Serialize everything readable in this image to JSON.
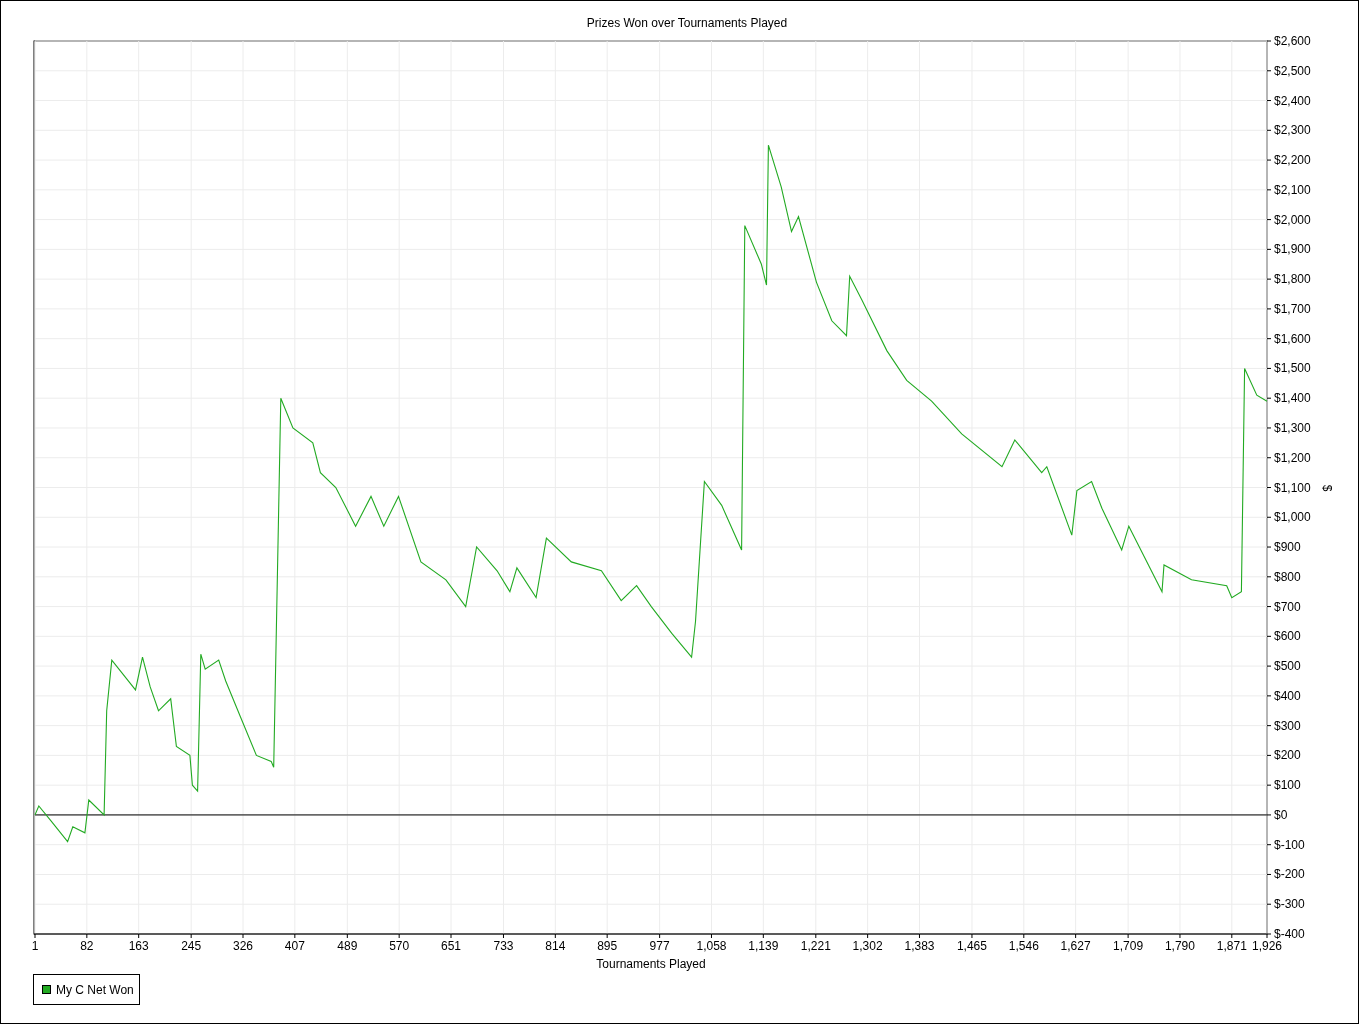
{
  "chart": {
    "chart_data": {
      "type": "line",
      "title": "Prizes Won over Tournaments Played",
      "xlabel": "Tournaments Played",
      "ylabel": "$",
      "x": [
        1,
        7,
        26,
        52,
        60,
        79,
        85,
        109,
        113,
        121,
        158,
        169,
        181,
        194,
        213,
        222,
        243,
        247,
        255,
        260,
        267,
        288,
        299,
        322,
        347,
        370,
        374,
        380,
        385,
        404,
        435,
        447,
        471,
        502,
        526,
        546,
        569,
        604,
        643,
        674,
        691,
        723,
        743,
        754,
        784,
        800,
        839,
        886,
        917,
        941,
        964,
        996,
        1027,
        1033,
        1047,
        1074,
        1105,
        1110,
        1136,
        1144,
        1147,
        1167,
        1183,
        1194,
        1222,
        1246,
        1269,
        1274,
        1293,
        1332,
        1363,
        1402,
        1449,
        1512,
        1532,
        1574,
        1582,
        1621,
        1629,
        1652,
        1668,
        1699,
        1710,
        1762,
        1765,
        1808,
        1863,
        1871,
        1886,
        1891,
        1910,
        1926
      ],
      "series": [
        {
          "name": "My C Net Won",
          "color": "#22aa22",
          "values": [
            0,
            30,
            -20,
            -90,
            -40,
            -60,
            50,
            0,
            350,
            520,
            420,
            530,
            430,
            350,
            390,
            230,
            200,
            100,
            80,
            540,
            490,
            520,
            450,
            330,
            200,
            180,
            160,
            840,
            1400,
            1300,
            1250,
            1150,
            1100,
            970,
            1070,
            970,
            1070,
            850,
            790,
            700,
            900,
            820,
            750,
            830,
            730,
            930,
            850,
            820,
            720,
            770,
            700,
            610,
            530,
            650,
            1120,
            1040,
            890,
            1980,
            1850,
            1780,
            2250,
            2110,
            1960,
            2010,
            1790,
            1660,
            1610,
            1810,
            1730,
            1560,
            1460,
            1390,
            1280,
            1170,
            1260,
            1150,
            1170,
            940,
            1090,
            1120,
            1030,
            890,
            970,
            750,
            840,
            790,
            770,
            730,
            750,
            1500,
            1410,
            1390
          ]
        }
      ],
      "grid": true,
      "xlim": [
        1,
        1926
      ],
      "ylim": [
        -400,
        2600
      ],
      "xticks": [
        1,
        82,
        163,
        245,
        326,
        407,
        489,
        570,
        651,
        733,
        814,
        895,
        977,
        {
          "value": 1058,
          "label": "1,058"
        },
        {
          "value": 1139,
          "label": "1,139"
        },
        {
          "value": 1221,
          "label": "1,221"
        },
        {
          "value": 1302,
          "label": "1,302"
        },
        {
          "value": 1383,
          "label": "1,383"
        },
        {
          "value": 1465,
          "label": "1,465"
        },
        {
          "value": 1546,
          "label": "1,546"
        },
        {
          "value": 1627,
          "label": "1,627"
        },
        {
          "value": 1709,
          "label": "1,709"
        },
        {
          "value": 1790,
          "label": "1,790"
        },
        {
          "value": 1871,
          "label": "1,871"
        },
        {
          "value": 1926,
          "label": "1,926"
        }
      ],
      "yticks": [
        {
          "value": -400,
          "label": "$-400"
        },
        {
          "value": -300,
          "label": "$-300"
        },
        {
          "value": -200,
          "label": "$-200"
        },
        {
          "value": -100,
          "label": "$-100"
        },
        {
          "value": 0,
          "label": "$0"
        },
        {
          "value": 100,
          "label": "$100"
        },
        {
          "value": 200,
          "label": "$200"
        },
        {
          "value": 300,
          "label": "$300"
        },
        {
          "value": 400,
          "label": "$400"
        },
        {
          "value": 500,
          "label": "$500"
        },
        {
          "value": 600,
          "label": "$600"
        },
        {
          "value": 700,
          "label": "$700"
        },
        {
          "value": 800,
          "label": "$800"
        },
        {
          "value": 900,
          "label": "$900"
        },
        {
          "value": 1000,
          "label": "$1,000"
        },
        {
          "value": 1100,
          "label": "$1,100"
        },
        {
          "value": 1200,
          "label": "$1,200"
        },
        {
          "value": 1300,
          "label": "$1,300"
        },
        {
          "value": 1400,
          "label": "$1,400"
        },
        {
          "value": 1500,
          "label": "$1,500"
        },
        {
          "value": 1600,
          "label": "$1,600"
        },
        {
          "value": 1700,
          "label": "$1,700"
        },
        {
          "value": 1800,
          "label": "$1,800"
        },
        {
          "value": 1900,
          "label": "$1,900"
        },
        {
          "value": 2000,
          "label": "$2,000"
        },
        {
          "value": 2100,
          "label": "$2,100"
        },
        {
          "value": 2200,
          "label": "$2,200"
        },
        {
          "value": 2300,
          "label": "$2,300"
        },
        {
          "value": 2400,
          "label": "$2,400"
        },
        {
          "value": 2500,
          "label": "$2,500"
        },
        {
          "value": 2600,
          "label": "$2,600"
        }
      ]
    }
  }
}
